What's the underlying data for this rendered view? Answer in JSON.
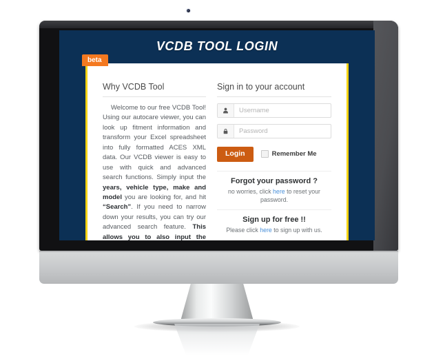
{
  "screen": {
    "title": "VCDB TOOL LOGIN",
    "badge": "beta",
    "colors": {
      "screen_bg": "#0c3055",
      "card_border": "#f5d312",
      "badge_bg": "#f47920",
      "login_button": "#cc5c12",
      "link": "#4a90d9"
    }
  },
  "left_column": {
    "heading": "Why VCDB Tool",
    "paragraph": {
      "part1": "Welcome to our free VCDB Tool! Using our autocare viewer, you can look up fitment information and transform your Excel spreadsheet into fully formatted ACES XML data. Our VCDB viewer is easy to use with quick and advanced search functions. Simply input the ",
      "bold1": "years, vehicle type, make and model",
      "part2": " you are looking for, and hit ",
      "bold2": "“Search”",
      "part3": ". If you need to narrow down your results, you can try our advanced search feature. ",
      "bold3": "This allows you to also input the region, submodel, litter, CC, CID, and cylinders."
    }
  },
  "right_column": {
    "heading": "Sign in to your account",
    "username": {
      "placeholder": "Username",
      "value": "",
      "icon": "user-icon"
    },
    "password": {
      "placeholder": "Password",
      "value": "",
      "icon": "lock-icon"
    },
    "login_label": "Login",
    "remember_label": "Remember Me",
    "forgot": {
      "title": "Forgot your password ?",
      "text_before": "no worries, click ",
      "link": "here",
      "text_after": " to reset your password."
    },
    "signup": {
      "title": "Sign up for free !!",
      "text_before": "Please click ",
      "link": "here",
      "text_after": " to sign up with us."
    }
  }
}
